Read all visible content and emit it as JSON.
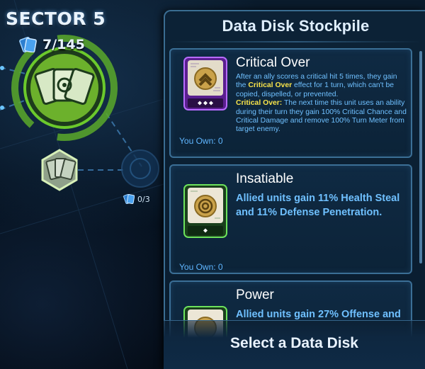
{
  "sector": {
    "title": "SECTOR 5",
    "progress_text": "7/145",
    "node_progress_text": "0/3",
    "accent_green": "#8ede3a"
  },
  "panel": {
    "title": "Data Disk Stockpile",
    "cards": [
      {
        "name": "Critical Over",
        "rarity_color": "#a64bff",
        "icon": "chevron-up-icon",
        "desc_parts": [
          "After an ally scores a critical hit 5 times, they gain the ",
          "Critical Over",
          " effect for 1 turn, which can't be copied, dispelled, or prevented.",
          "Critical Over:",
          " The next time this unit uses an ability during their turn they gain 100% Critical Chance and Critical Damage and remove 100% Turn Meter from target enemy."
        ],
        "you_own": "You Own: 0",
        "pips": 3
      },
      {
        "name": "Insatiable",
        "rarity_color": "#55e04b",
        "icon": "target-rings-icon",
        "description": "Allied units gain 11% Health Steal and 11% Defense Penetration.",
        "you_own": "You Own: 0",
        "pips": 1
      },
      {
        "name": "Power",
        "rarity_color": "#55e04b",
        "icon": "power-icon",
        "description": "Allied units gain 27% Offense and"
      }
    ]
  },
  "footer": {
    "select_label": "Select a Data Disk"
  }
}
